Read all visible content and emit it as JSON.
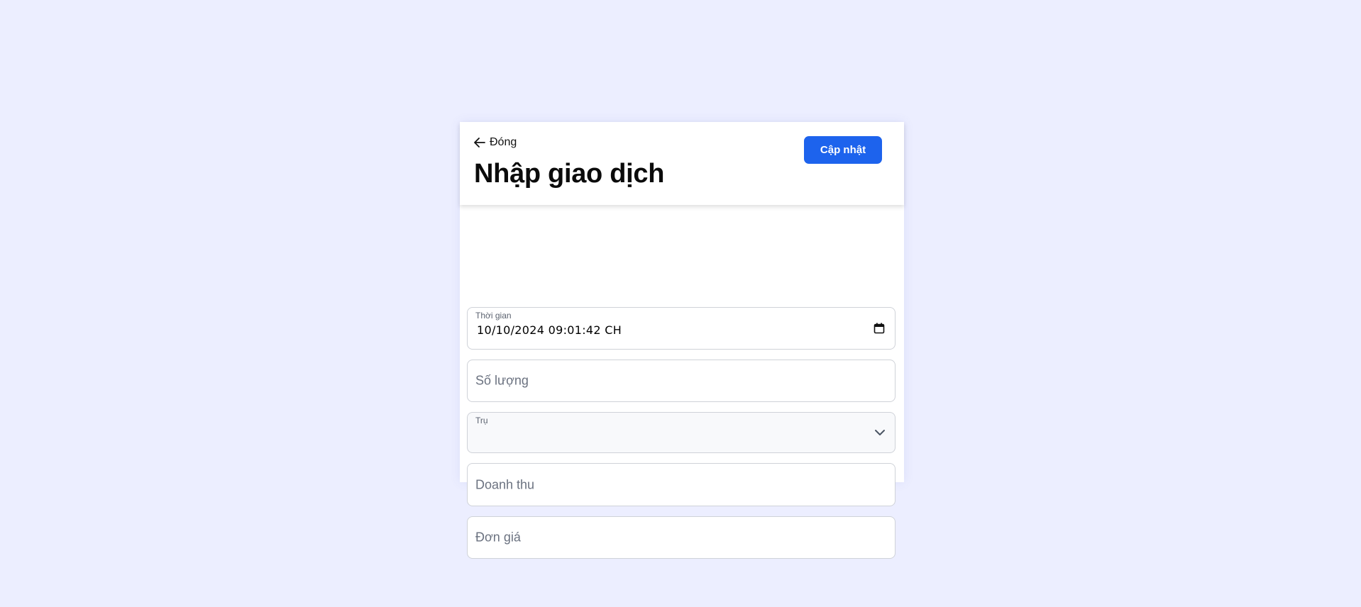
{
  "header": {
    "back_label": "Đóng",
    "title": "Nhập giao dịch",
    "update_label": "Cập nhật"
  },
  "form": {
    "time": {
      "label": "Thời gian",
      "value": "10/10/2024 09:01:42 CH",
      "icon": "calendar-icon"
    },
    "quantity": {
      "placeholder": "Số lượng"
    },
    "pump": {
      "label": "Trụ",
      "value": "",
      "icon": "chevron-down-icon"
    },
    "revenue": {
      "placeholder": "Doanh thu"
    },
    "unit_price": {
      "placeholder": "Đơn giá"
    }
  },
  "colors": {
    "background": "#eceeff",
    "accent": "#1d63ed"
  }
}
